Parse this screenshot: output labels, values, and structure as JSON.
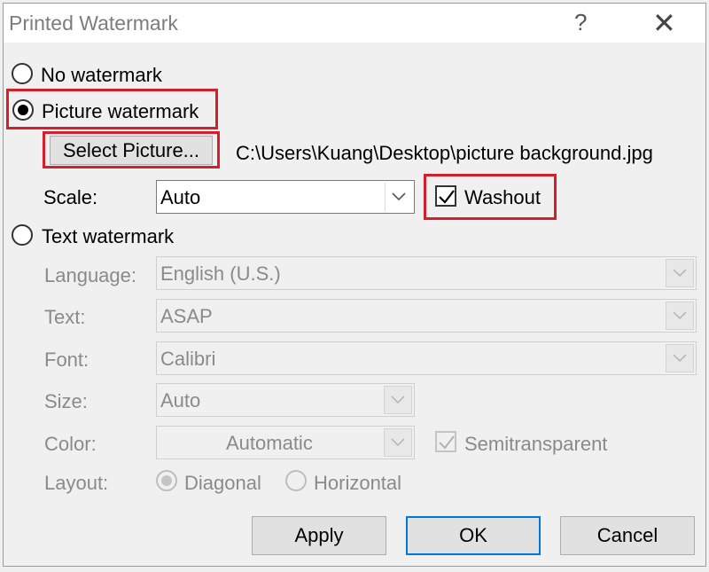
{
  "window": {
    "title": "Printed Watermark",
    "help": "?",
    "close": "✕"
  },
  "options": {
    "no_watermark": "No watermark",
    "picture_watermark": "Picture watermark",
    "text_watermark": "Text watermark"
  },
  "picture": {
    "select_button": "Select Picture...",
    "path": "C:\\Users\\Kuang\\Desktop\\picture background.jpg",
    "scale_label": "Scale:",
    "scale_value": "Auto",
    "washout_label": "Washout",
    "washout_checked": true
  },
  "text": {
    "language_label": "Language:",
    "language_value": "English (U.S.)",
    "text_label": "Text:",
    "text_value": "ASAP",
    "font_label": "Font:",
    "font_value": "Calibri",
    "size_label": "Size:",
    "size_value": "Auto",
    "color_label": "Color:",
    "color_value": "Automatic",
    "semitransparent_label": "Semitransparent",
    "semitransparent_checked": true,
    "layout_label": "Layout:",
    "layout_diagonal": "Diagonal",
    "layout_horizontal": "Horizontal"
  },
  "buttons": {
    "apply": "Apply",
    "ok": "OK",
    "cancel": "Cancel"
  },
  "colors": {
    "highlight": "#d4202c",
    "ok_border": "#0078d7",
    "disabled_text": "#8a8a8a"
  }
}
